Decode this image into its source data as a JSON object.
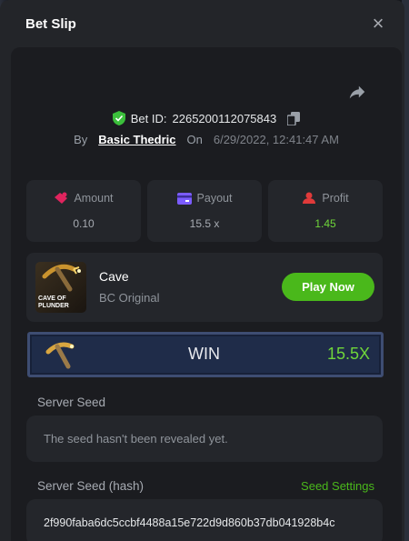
{
  "header": {
    "title": "Bet Slip",
    "close_glyph": "×"
  },
  "bet": {
    "id_label": "Bet ID:",
    "id_value": "2265200112075843",
    "by_label": "By",
    "user": "Basic Thedric",
    "on_label": "On",
    "datetime": "6/29/2022, 12:41:47 AM"
  },
  "stats": {
    "amount_label": "Amount",
    "amount_value": "0.10",
    "payout_label": "Payout",
    "payout_value": "15.5 x",
    "profit_label": "Profit",
    "profit_value": "1.45"
  },
  "game": {
    "name": "Cave",
    "provider": "BC Original",
    "thumb_text_1": "CAVE OF",
    "thumb_text_2": "PLUNDER",
    "play_label": "Play Now"
  },
  "result": {
    "label": "WIN",
    "multiplier": "15.5X"
  },
  "seeds": {
    "server_seed_label": "Server Seed",
    "server_seed_value": "The seed hasn't been revealed yet.",
    "hash_label": "Server Seed (hash)",
    "settings_label": "Seed Settings",
    "hash_value": "2f990faba6dc5ccbf4488a15e722d9d860b37db041928b4c"
  },
  "colors": {
    "accent_green": "#4ab81b",
    "profit_green": "#6fd63a",
    "amount_icon": "#e0245e",
    "payout_icon": "#7b5cff",
    "profit_icon": "#e03a3a"
  },
  "icons": [
    "close-icon",
    "share-icon",
    "shield-check-icon",
    "copy-icon",
    "amount-icon",
    "payout-icon",
    "profit-icon",
    "pickaxe-icon"
  ]
}
